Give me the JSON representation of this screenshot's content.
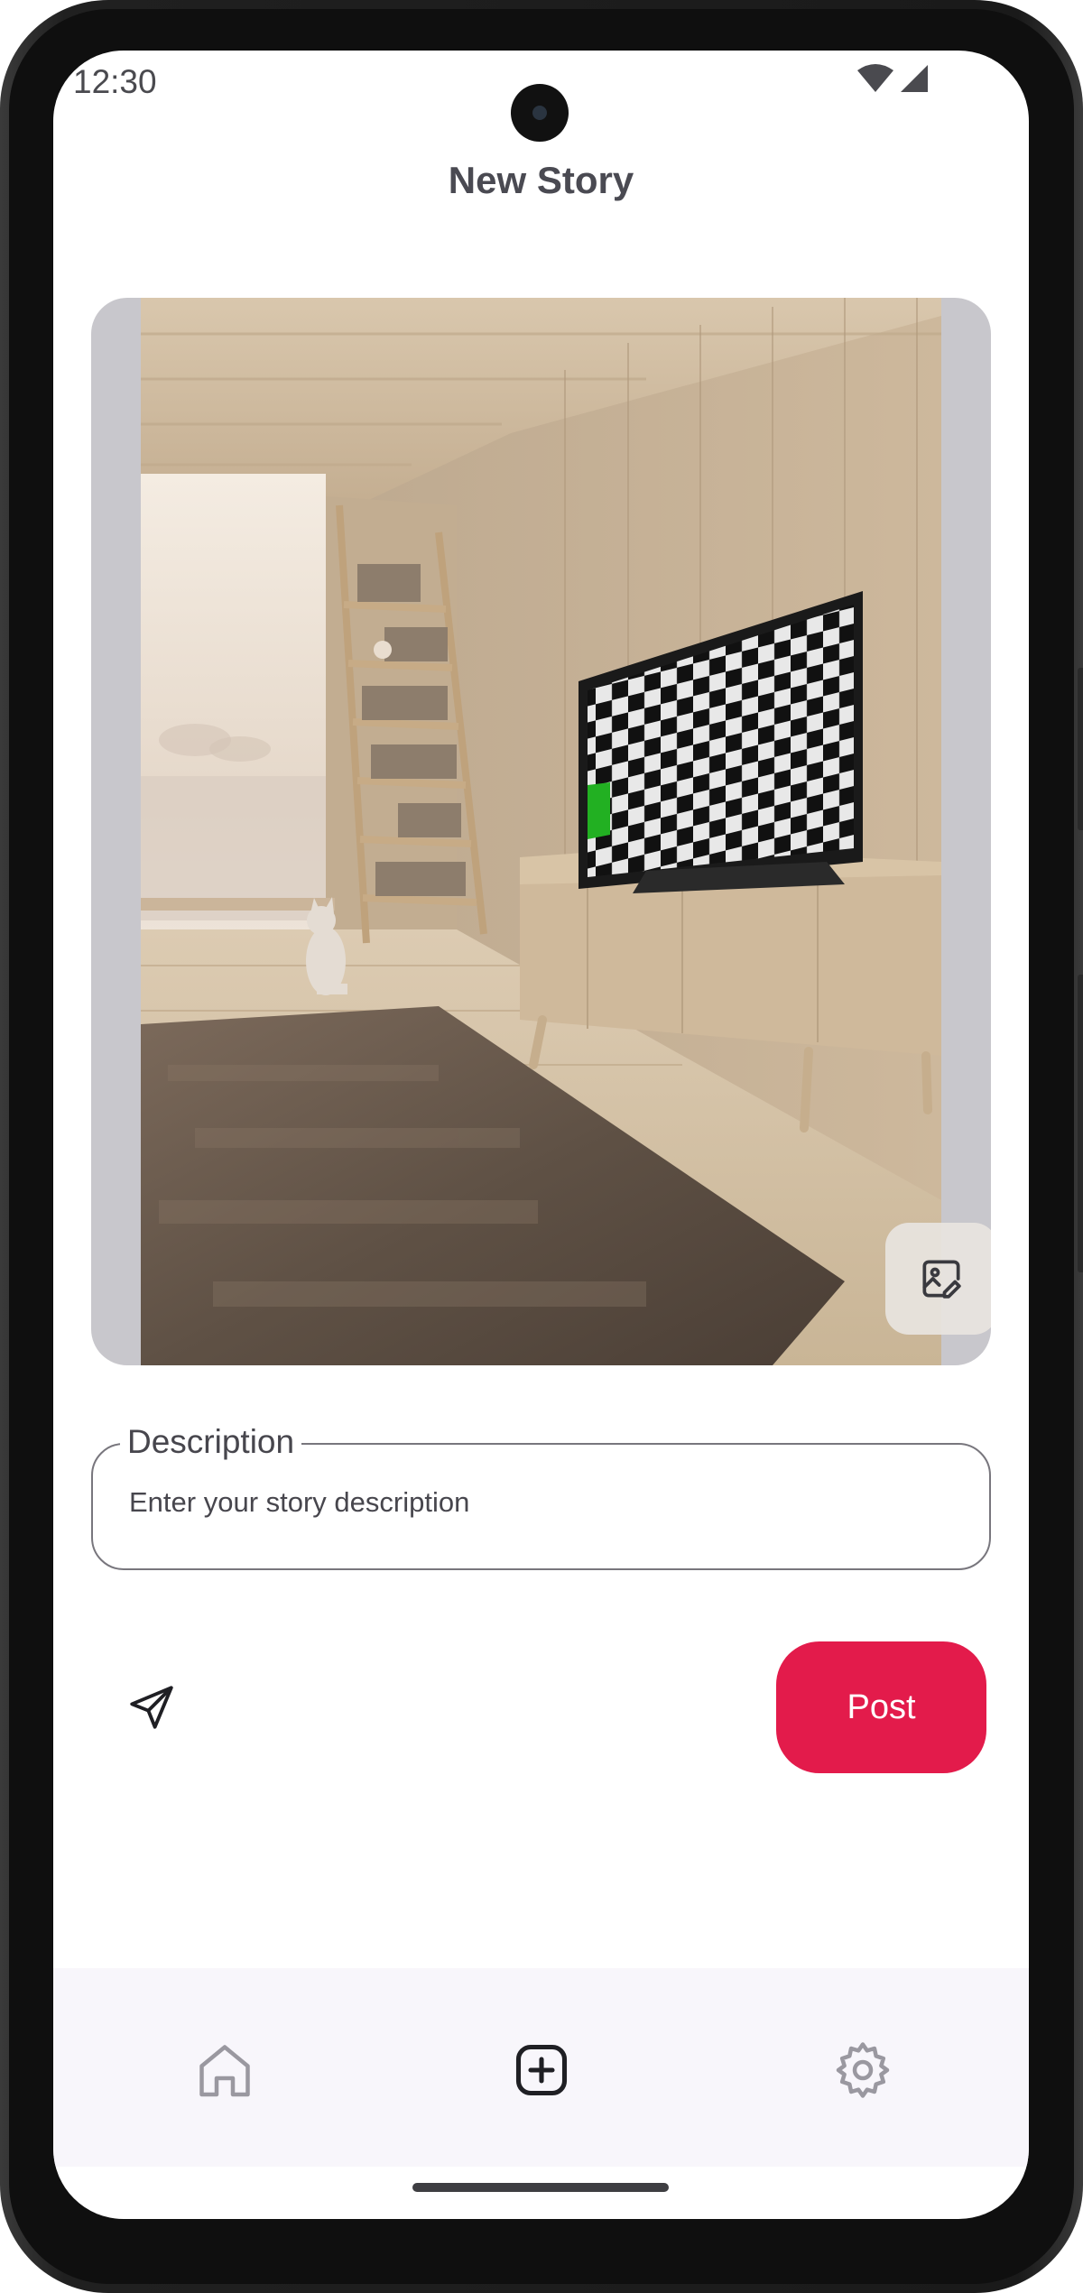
{
  "status_bar": {
    "time": "12:30"
  },
  "header": {
    "title": "New Story"
  },
  "story_image": {
    "alt": "Living room scene"
  },
  "description": {
    "label": "Description",
    "placeholder": "Enter your story description",
    "value": ""
  },
  "actions": {
    "post_label": "Post"
  },
  "bottom_nav": {
    "items": [
      {
        "icon": "home-icon"
      },
      {
        "icon": "add-box-icon"
      },
      {
        "icon": "settings-icon"
      }
    ]
  },
  "colors": {
    "accent": "#e31b4b",
    "image_background": "#c8c7cc",
    "nav_background": "#f8f6fb"
  }
}
